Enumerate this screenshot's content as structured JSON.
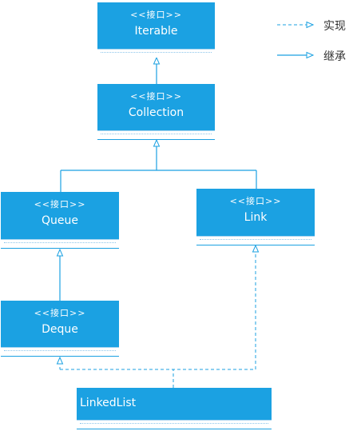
{
  "diagram": {
    "nodes": {
      "iterable": {
        "stereotype": "<<接口>>",
        "name": "Iterable"
      },
      "collection": {
        "stereotype": "<<接口>>",
        "name": "Collection"
      },
      "queue": {
        "stereotype": "<<接口>>",
        "name": "Queue"
      },
      "link": {
        "stereotype": "<<接口>>",
        "name": "Link"
      },
      "deque": {
        "stereotype": "<<接口>>",
        "name": "Deque"
      },
      "linkedlist": {
        "name": "LinkedList"
      }
    },
    "edges": [
      {
        "from": "Collection",
        "to": "Iterable",
        "kind": "inheritance"
      },
      {
        "from": "Queue",
        "to": "Collection",
        "kind": "inheritance"
      },
      {
        "from": "Link",
        "to": "Collection",
        "kind": "inheritance"
      },
      {
        "from": "Deque",
        "to": "Queue",
        "kind": "inheritance"
      },
      {
        "from": "LinkedList",
        "to": "Deque",
        "kind": "realization"
      },
      {
        "from": "LinkedList",
        "to": "Link",
        "kind": "realization"
      }
    ]
  },
  "legend": {
    "realization_label": "实现",
    "inheritance_label": "继承"
  },
  "colors": {
    "box_fill": "#1ba1e2",
    "line": "#1ba1e2",
    "text": "#ffffff"
  }
}
